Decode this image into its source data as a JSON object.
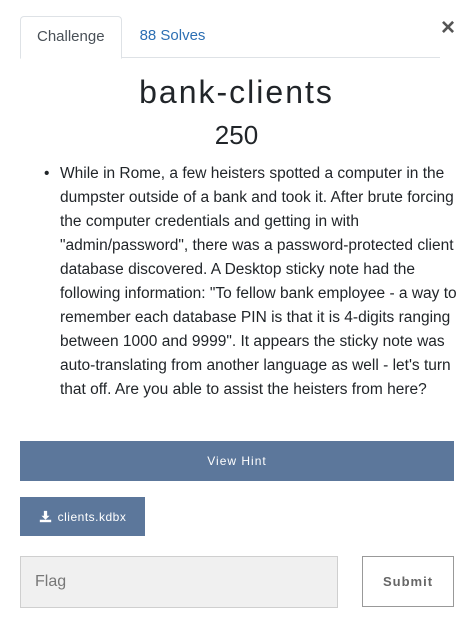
{
  "tabs": {
    "challenge": "Challenge",
    "solves": "88 Solves"
  },
  "close_glyph": "×",
  "challenge": {
    "name": "bank-clients",
    "points": "250",
    "description": "While in Rome, a few heisters spotted a computer in the dumpster outside of a bank and took it. After brute forcing the computer credentials and getting in with \"admin/password\", there was a password-protected client database discovered. A Desktop sticky note had the following information: \"To fellow bank employee - a way to remember each database PIN is that it is 4-digits ranging between 1000 and 9999\". It appears the sticky note was auto-translating from another language as well - let's turn that off. Are you able to assist the heisters from here?"
  },
  "hint_button": "View Hint",
  "file": {
    "icon": "download-icon",
    "label": "clients.kdbx"
  },
  "flag_input": {
    "placeholder": "Flag"
  },
  "submit_button": "Submit",
  "colors": {
    "button_bg": "#5c779b",
    "tab_link": "#2c6fb3"
  }
}
